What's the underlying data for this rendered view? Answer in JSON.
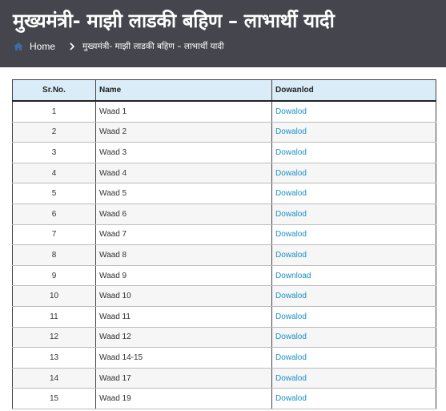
{
  "page": {
    "title": "मुख्यमंत्री- माझी लाडकी बहिण – लाभार्थी यादी",
    "accent": "#1a8fc4",
    "header_bg": "#45454d"
  },
  "breadcrumb": {
    "home": "Home",
    "current": "मुख्यमंत्री- माझी लाडकी बहिण – लाभार्थी यादी",
    "icons": [
      "home-icon",
      "chevron-right-icon"
    ]
  },
  "table": {
    "headers": [
      "Sr.No.",
      "Name",
      "Dowanlod"
    ],
    "rows": [
      {
        "sr": "1",
        "name": "Waad 1",
        "link": "Dowalod"
      },
      {
        "sr": "2",
        "name": "Waad 2",
        "link": "Dowalod"
      },
      {
        "sr": "3",
        "name": "Waad 3",
        "link": "Dowalod"
      },
      {
        "sr": "4",
        "name": "Waad 4",
        "link": "Dowalod"
      },
      {
        "sr": "5",
        "name": "Waad 5",
        "link": "Dowalod"
      },
      {
        "sr": "6",
        "name": "Waad 6",
        "link": "Dowalod"
      },
      {
        "sr": "7",
        "name": "Waad 7",
        "link": "Dowalod"
      },
      {
        "sr": "8",
        "name": "Waad 8",
        "link": "Dowalod"
      },
      {
        "sr": "9",
        "name": "Waad 9",
        "link": "Download"
      },
      {
        "sr": "10",
        "name": "Waad 10",
        "link": "Dowalod"
      },
      {
        "sr": "11",
        "name": "Waad 11",
        "link": "Dowalod"
      },
      {
        "sr": "12",
        "name": "Waad 12",
        "link": "Dowalod"
      },
      {
        "sr": "13",
        "name": "Waad 14-15",
        "link": "Dowalod"
      },
      {
        "sr": "14",
        "name": "Waad 17",
        "link": "Dowalod"
      },
      {
        "sr": "15",
        "name": "Waad 19",
        "link": "Dowalod"
      }
    ]
  }
}
